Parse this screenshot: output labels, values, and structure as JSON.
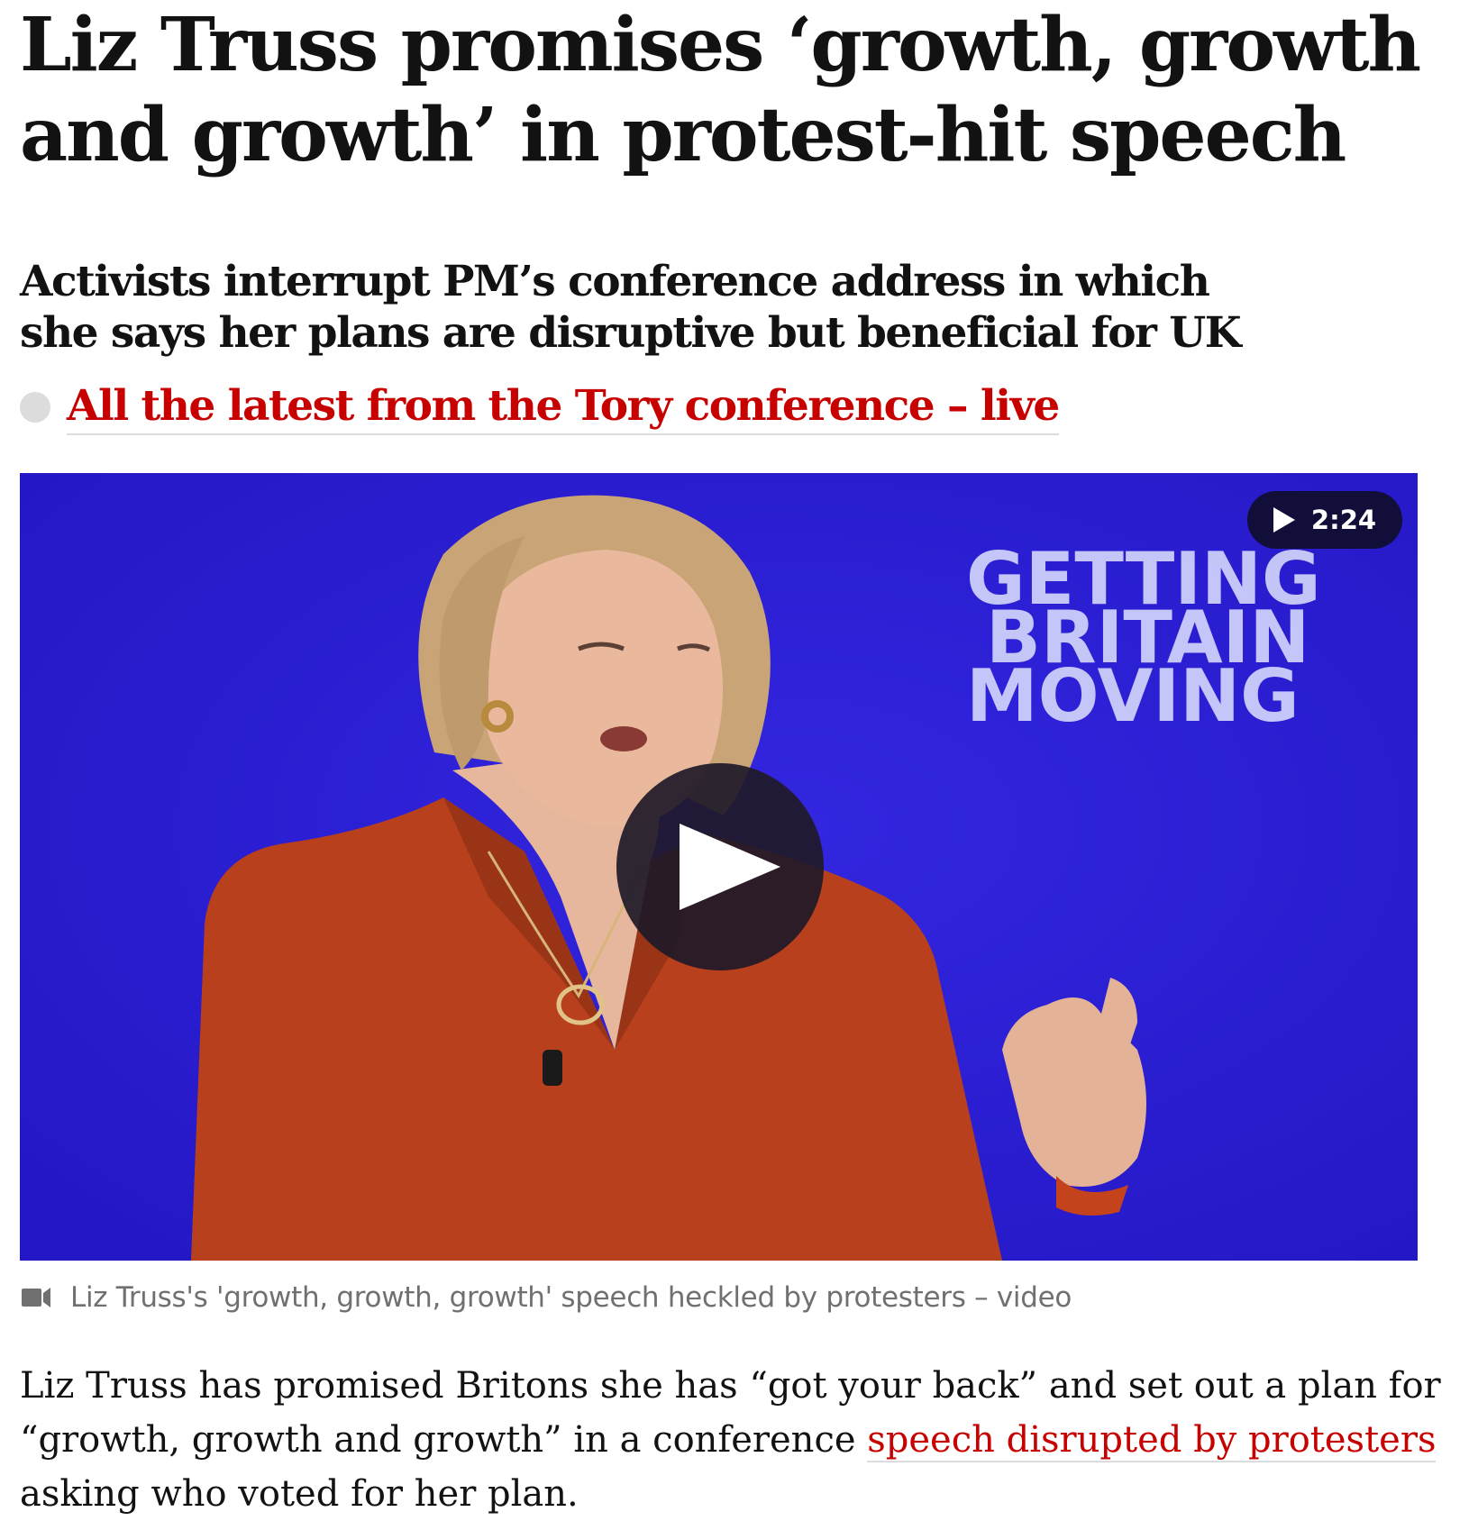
{
  "article": {
    "headline": "Liz Truss promises ‘growth, growth and growth’ in protest-hit speech",
    "standfirst": "Activists interrupt PM’s conference address in which she says her plans are disruptive but beneficial for UK",
    "live_link": "All the latest from the Tory conference – live",
    "media": {
      "duration": "2:24",
      "backdrop_text": [
        "GETTING",
        "BRITAIN",
        "MOVING"
      ],
      "caption": "Liz Truss's 'growth, growth, growth' speech heckled by protesters – video"
    },
    "body": {
      "before_link": "Liz Truss has promised Britons she has “got your back” and set out a plan for “growth, growth and growth” in a conference ",
      "link_text": "speech disrupted by protesters",
      "after_link": " asking who voted for her plan."
    }
  },
  "colors": {
    "link_red": "#c70000",
    "stage_blue": "#2a1fd4",
    "caption_grey": "#707070"
  },
  "icons": {
    "live": "dot-icon",
    "duration": "play-icon",
    "caption": "video-camera-icon"
  }
}
